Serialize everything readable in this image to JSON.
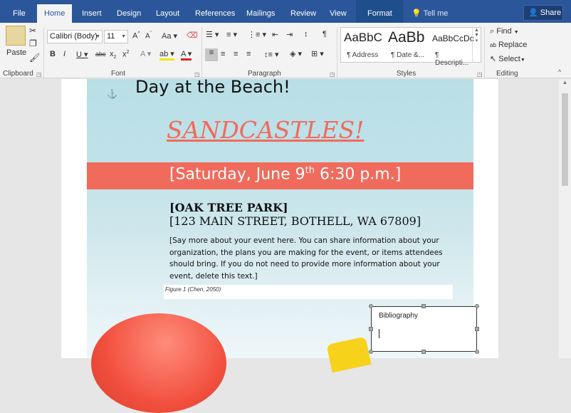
{
  "tabs": [
    "File",
    "Home",
    "Insert",
    "Design",
    "Layout",
    "References",
    "Mailings",
    "Review",
    "View",
    "Format"
  ],
  "active_tab": "Home",
  "tell_me": "Tell me",
  "share": "Share",
  "clipboard": {
    "paste": "Paste",
    "label": "Clipboard"
  },
  "font": {
    "family": "Calibri (Body)",
    "size": "11",
    "label": "Font"
  },
  "paragraph": {
    "label": "Paragraph"
  },
  "styles": {
    "label": "Styles",
    "items": [
      {
        "sample": "AaBbC",
        "name": "¶ Address"
      },
      {
        "sample": "AaBb",
        "name": "¶ Date &..."
      },
      {
        "sample": "AaBbCcDc",
        "name": "¶ Descripti..."
      }
    ]
  },
  "editing": {
    "find": "Find",
    "replace": "Replace",
    "select": "Select",
    "label": "Editing"
  },
  "document": {
    "heading": "Day at the Beach!",
    "title": "SANDCASTLES!",
    "date_main": "[Saturday, June 9",
    "date_sup": "th",
    "date_rest": " 6:30 p.m.]",
    "venue": "[OAK TREE PARK]",
    "address": "[123 MAIN STREET, BOTHELL, WA 67809]",
    "body": "[Say more about your event here. You can share information about your organization, the plans you are making for the event, or items attendees should bring. If you do not need to provide more information about your event, delete this text.]",
    "caption": "Figure 1 (Chen, 2050)",
    "bibliography_title": "Bibliography"
  },
  "colors": {
    "accent": "#2b579a",
    "flyer_coral": "#f06b5c",
    "flyer_sky": "#b9dfe6"
  }
}
